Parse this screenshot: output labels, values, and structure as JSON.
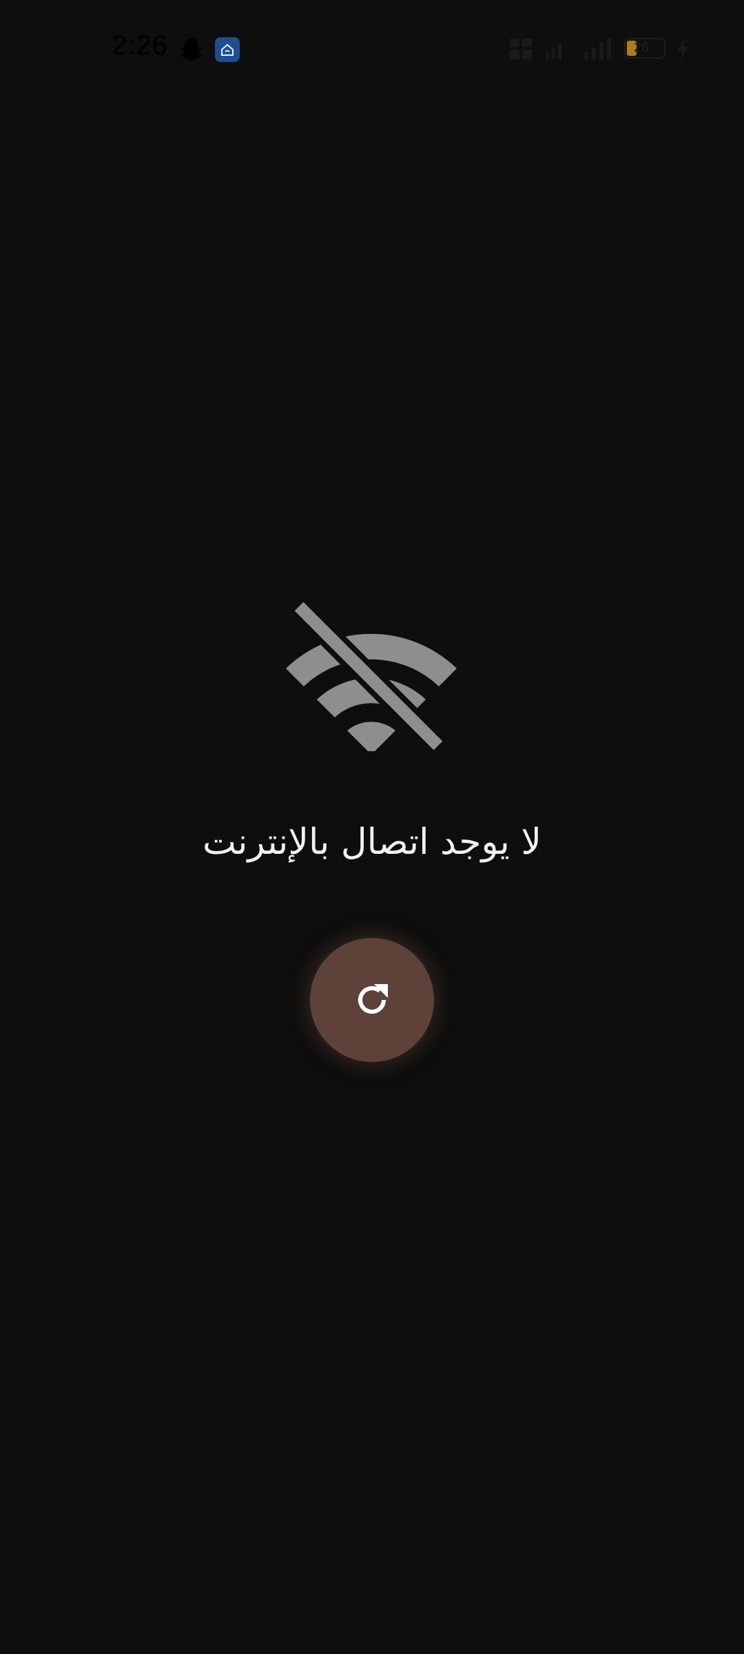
{
  "status_bar": {
    "time": "2:26",
    "battery_level": "26",
    "battery_fraction": 0.26,
    "icons": [
      "snapchat-icon",
      "home-app-icon",
      "volte-icon",
      "signal-icon",
      "signal-icon",
      "battery-icon",
      "charging-bolt-icon"
    ]
  },
  "main": {
    "status_icon": "wifi-off-icon",
    "message": "لا يوجد اتصال بالإنترنت",
    "retry_icon": "refresh-icon"
  },
  "colors": {
    "background": "#0e0e0e",
    "icon_gray": "#8e8e8e",
    "retry_button": "#5e4139",
    "battery_fill": "#b07a1e",
    "text": "#f2f2f2"
  }
}
